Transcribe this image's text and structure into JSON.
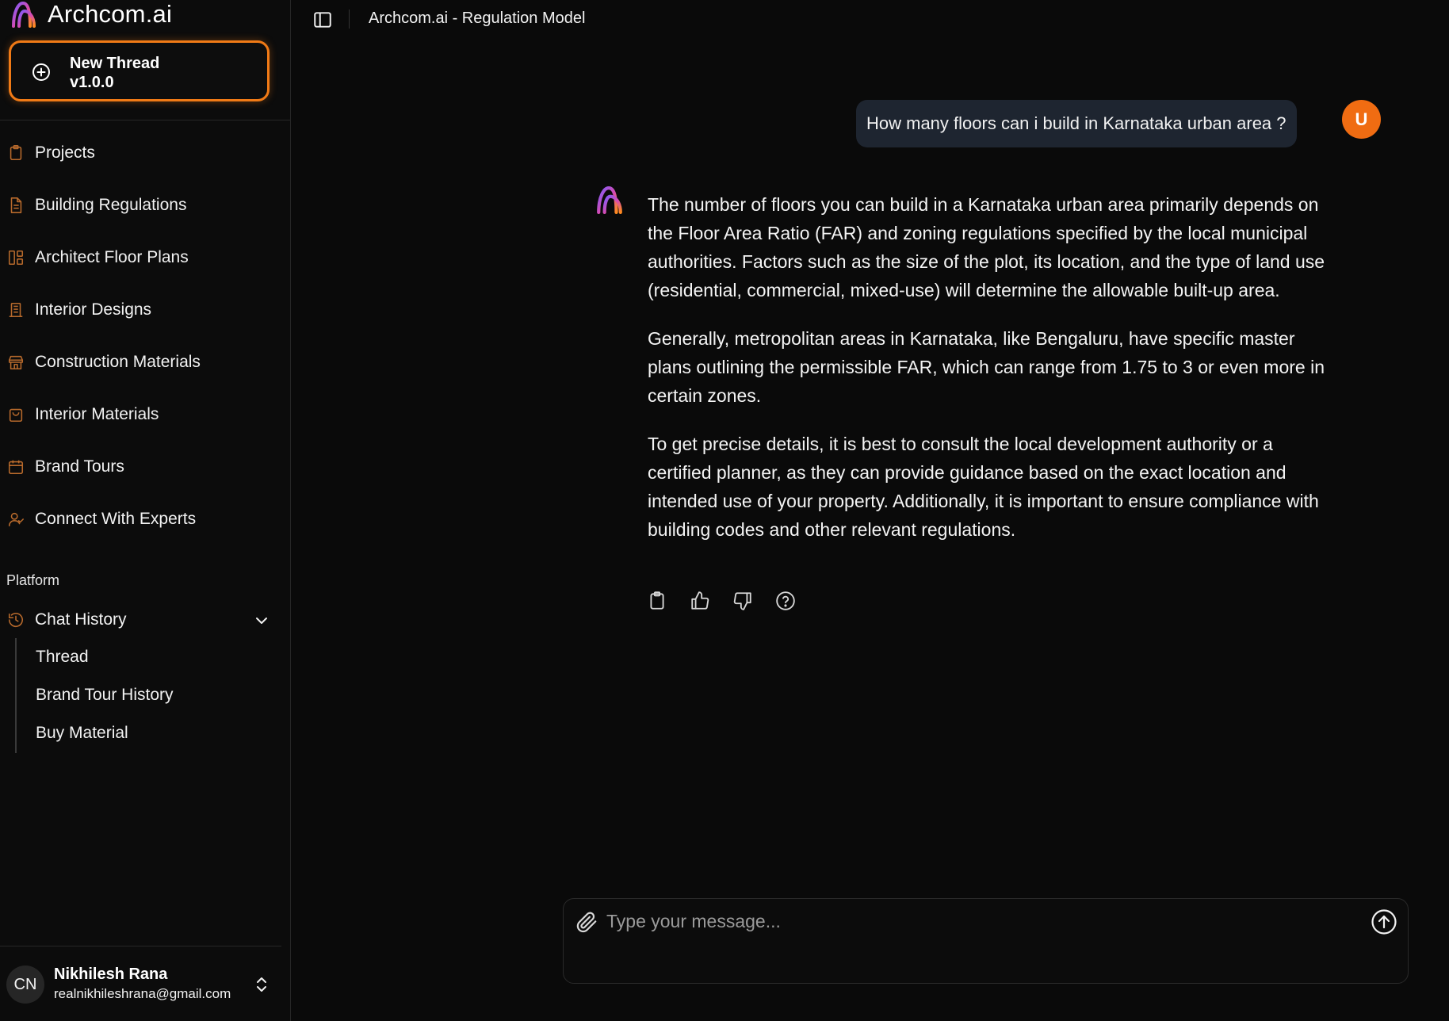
{
  "brand": {
    "name": "Archcom.ai"
  },
  "new_thread": {
    "label": "New Thread",
    "version": "v1.0.0"
  },
  "nav": [
    {
      "label": "Projects",
      "icon": "clipboard-icon"
    },
    {
      "label": "Building Regulations",
      "icon": "document-icon"
    },
    {
      "label": "Architect Floor Plans",
      "icon": "layout-icon"
    },
    {
      "label": "Interior Designs",
      "icon": "building-icon"
    },
    {
      "label": "Construction Materials",
      "icon": "store-icon"
    },
    {
      "label": "Interior Materials",
      "icon": "shopping-bag-icon"
    },
    {
      "label": "Brand Tours",
      "icon": "calendar-icon"
    },
    {
      "label": "Connect With Experts",
      "icon": "user-check-icon"
    }
  ],
  "platform": {
    "label": "Platform",
    "chat_history": {
      "label": "Chat History",
      "items": [
        "Thread",
        "Brand Tour History",
        "Buy Material"
      ]
    }
  },
  "user": {
    "initials": "CN",
    "name": "Nikhilesh Rana",
    "email": "realnikhileshrana@gmail.com"
  },
  "header": {
    "title": "Archcom.ai - Regulation Model"
  },
  "chat": {
    "user_message": "How many floors can i build in Karnataka urban area ?",
    "user_avatar": "U",
    "ai_paragraphs": [
      "The number of floors you can build in a Karnataka urban area primarily depends on the Floor Area Ratio (FAR) and zoning regulations specified by the local municipal authorities. Factors such as the size of the plot, its location, and the type of land use (residential, commercial, mixed-use) will determine the allowable built-up area.",
      "Generally, metropolitan areas in Karnataka, like Bengaluru, have specific master plans outlining the permissible FAR, which can range from 1.75 to 3 or even more in certain zones.",
      "To get precise details, it is best to consult the local development authority or a certified planner, as they can provide guidance based on the exact location and intended use of your property. Additionally, it is important to ensure compliance with building codes and other relevant regulations."
    ]
  },
  "composer": {
    "placeholder": "Type your message..."
  },
  "colors": {
    "accent": "#f07a16",
    "avatar": "#f06c12",
    "user_bubble": "#1e2530",
    "background": "#0a0a0a"
  }
}
